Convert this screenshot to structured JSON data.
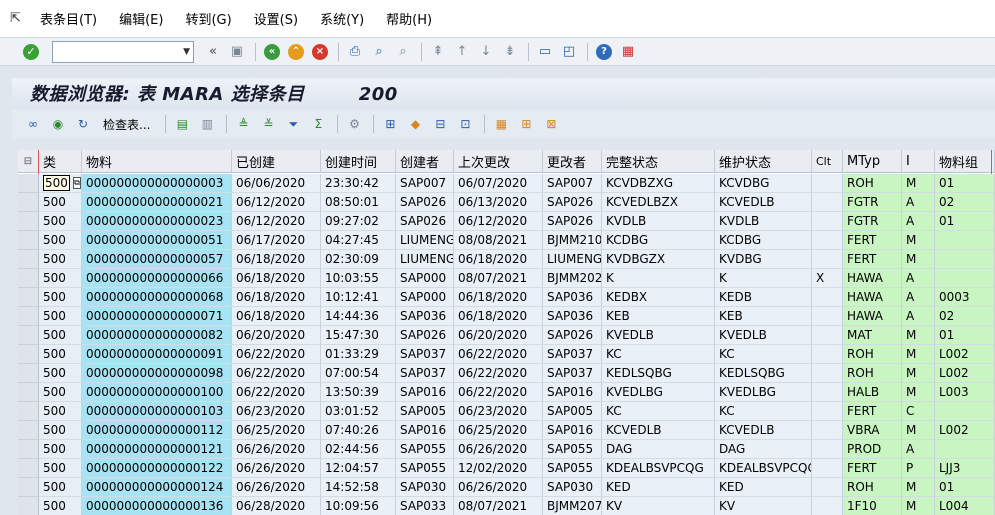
{
  "menu": {
    "items": [
      "表条目(T)",
      "编辑(E)",
      "转到(G)",
      "设置(S)",
      "系统(Y)",
      "帮助(H)"
    ]
  },
  "toolbar": {
    "command_value": "",
    "prev_label": "«"
  },
  "title": "数据浏览器: 表 MARA 选择条目        200",
  "app_toolbar": {
    "check_table_label": "检查表..."
  },
  "grid": {
    "columns": [
      "类",
      "物料",
      "已创建",
      "创建时间",
      "创建者",
      "上次更改",
      "更改者",
      "完整状态",
      "维护状态",
      "Clt",
      "MTyp",
      "I",
      "物料组"
    ],
    "rows": [
      [
        "500",
        "000000000000000003",
        "06/06/2020",
        "23:30:42",
        "SAP007",
        "06/07/2020",
        "SAP007",
        "KCVDBZXG",
        "KCVDBG",
        "",
        "ROH",
        "M",
        "01"
      ],
      [
        "500",
        "000000000000000021",
        "06/12/2020",
        "08:50:01",
        "SAP026",
        "06/13/2020",
        "SAP026",
        "KCVEDLBZX",
        "KCVEDLB",
        "",
        "FGTR",
        "A",
        "02"
      ],
      [
        "500",
        "000000000000000023",
        "06/12/2020",
        "09:27:02",
        "SAP026",
        "06/12/2020",
        "SAP026",
        "KVDLB",
        "KVDLB",
        "",
        "FGTR",
        "A",
        "01"
      ],
      [
        "500",
        "000000000000000051",
        "06/17/2020",
        "04:27:45",
        "LIUMENG",
        "08/08/2021",
        "BJMM210",
        "KCDBG",
        "KCDBG",
        "",
        "FERT",
        "M",
        ""
      ],
      [
        "500",
        "000000000000000057",
        "06/18/2020",
        "02:30:09",
        "LIUMENG",
        "06/18/2020",
        "LIUMENG",
        "KVDBGZX",
        "KVDBG",
        "",
        "FERT",
        "M",
        ""
      ],
      [
        "500",
        "000000000000000066",
        "06/18/2020",
        "10:03:55",
        "SAP000",
        "08/07/2021",
        "BJMM202",
        "K",
        "K",
        "X",
        "HAWA",
        "A",
        ""
      ],
      [
        "500",
        "000000000000000068",
        "06/18/2020",
        "10:12:41",
        "SAP000",
        "06/18/2020",
        "SAP036",
        "KEDBX",
        "KEDB",
        "",
        "HAWA",
        "A",
        "0003"
      ],
      [
        "500",
        "000000000000000071",
        "06/18/2020",
        "14:44:36",
        "SAP036",
        "06/18/2020",
        "SAP036",
        "KEB",
        "KEB",
        "",
        "HAWA",
        "A",
        "02"
      ],
      [
        "500",
        "000000000000000082",
        "06/20/2020",
        "15:47:30",
        "SAP026",
        "06/20/2020",
        "SAP026",
        "KVEDLB",
        "KVEDLB",
        "",
        "MAT",
        "M",
        "01"
      ],
      [
        "500",
        "000000000000000091",
        "06/22/2020",
        "01:33:29",
        "SAP037",
        "06/22/2020",
        "SAP037",
        "KC",
        "KC",
        "",
        "ROH",
        "M",
        "L002"
      ],
      [
        "500",
        "000000000000000098",
        "06/22/2020",
        "07:00:54",
        "SAP037",
        "06/22/2020",
        "SAP037",
        "KEDLSQBG",
        "KEDLSQBG",
        "",
        "ROH",
        "M",
        "L002"
      ],
      [
        "500",
        "000000000000000100",
        "06/22/2020",
        "13:50:39",
        "SAP016",
        "06/22/2020",
        "SAP016",
        "KVEDLBG",
        "KVEDLBG",
        "",
        "HALB",
        "M",
        "L003"
      ],
      [
        "500",
        "000000000000000103",
        "06/23/2020",
        "03:01:52",
        "SAP005",
        "06/23/2020",
        "SAP005",
        "KC",
        "KC",
        "",
        "FERT",
        "C",
        ""
      ],
      [
        "500",
        "000000000000000112",
        "06/25/2020",
        "07:40:26",
        "SAP016",
        "06/25/2020",
        "SAP016",
        "KCVEDLB",
        "KCVEDLB",
        "",
        "VBRA",
        "M",
        "L002"
      ],
      [
        "500",
        "000000000000000121",
        "06/26/2020",
        "02:44:56",
        "SAP055",
        "06/26/2020",
        "SAP055",
        "DAG",
        "DAG",
        "",
        "PROD",
        "A",
        ""
      ],
      [
        "500",
        "000000000000000122",
        "06/26/2020",
        "12:04:57",
        "SAP055",
        "12/02/2020",
        "SAP055",
        "KDEALBSVPCQG",
        "KDEALBSVPCQG",
        "",
        "FERT",
        "P",
        "LJJ3"
      ],
      [
        "500",
        "000000000000000124",
        "06/26/2020",
        "14:52:58",
        "SAP030",
        "06/26/2020",
        "SAP030",
        "KED",
        "KED",
        "",
        "ROH",
        "M",
        "01"
      ],
      [
        "500",
        "000000000000000136",
        "06/28/2020",
        "10:09:56",
        "SAP033",
        "08/07/2021",
        "BJMM207",
        "KV",
        "KV",
        "",
        "1F10",
        "M",
        "L004"
      ]
    ]
  }
}
